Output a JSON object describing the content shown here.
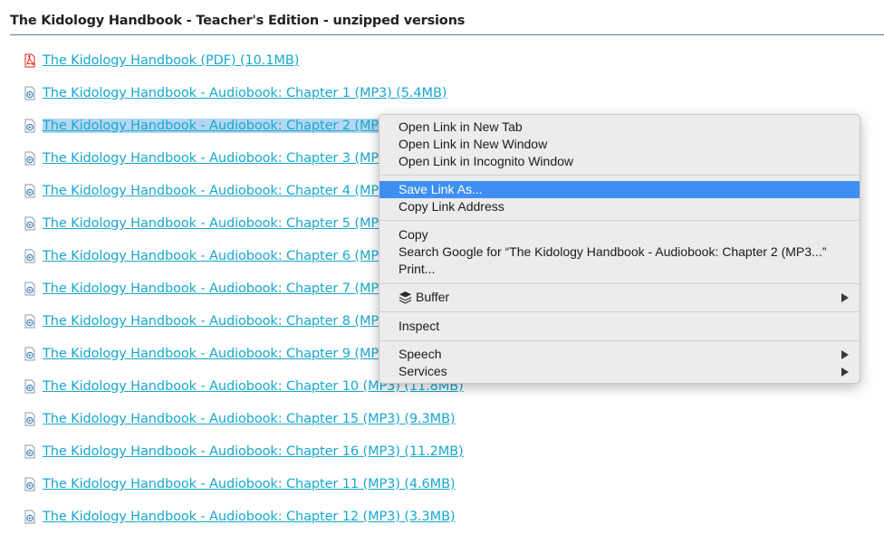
{
  "section": {
    "title": "The Kidology Handbook - Teacher's Edition - unzipped versions"
  },
  "files": [
    {
      "label": "The Kidology Handbook (PDF) (10.1MB)",
      "icon": "pdf-icon"
    },
    {
      "label": "The Kidology Handbook - Audiobook: Chapter 1 (MP3) (5.4MB)",
      "icon": "audio-file-icon"
    },
    {
      "label": "The Kidology Handbook - Audiobook: Chapter 2 (MP3",
      "icon": "audio-file-icon",
      "selected": true
    },
    {
      "label": "The Kidology Handbook - Audiobook: Chapter 3 (MP3",
      "icon": "audio-file-icon"
    },
    {
      "label": "The Kidology Handbook - Audiobook: Chapter 4 (MP3",
      "icon": "audio-file-icon"
    },
    {
      "label": "The Kidology Handbook - Audiobook: Chapter 5 (MP3",
      "icon": "audio-file-icon"
    },
    {
      "label": "The Kidology Handbook - Audiobook: Chapter 6 (MP3",
      "icon": "audio-file-icon"
    },
    {
      "label": "The Kidology Handbook - Audiobook: Chapter 7 (MP3",
      "icon": "audio-file-icon"
    },
    {
      "label": "The Kidology Handbook - Audiobook: Chapter 8 (MP3",
      "icon": "audio-file-icon"
    },
    {
      "label": "The Kidology Handbook - Audiobook: Chapter 9 (MP3",
      "icon": "audio-file-icon"
    },
    {
      "label": "The Kidology Handbook - Audiobook: Chapter 10 (MP3) (11.8MB)",
      "icon": "audio-file-icon"
    },
    {
      "label": "The Kidology Handbook - Audiobook: Chapter 15 (MP3) (9.3MB)",
      "icon": "audio-file-icon"
    },
    {
      "label": "The Kidology Handbook - Audiobook: Chapter 16 (MP3) (11.2MB)",
      "icon": "audio-file-icon"
    },
    {
      "label": "The Kidology Handbook - Audiobook: Chapter 11 (MP3) (4.6MB)",
      "icon": "audio-file-icon"
    },
    {
      "label": "The Kidology Handbook - Audiobook: Chapter 12 (MP3) (3.3MB)",
      "icon": "audio-file-icon"
    }
  ],
  "context_menu": {
    "open_new_tab": "Open Link in New Tab",
    "open_new_window": "Open Link in New Window",
    "open_incognito": "Open Link in Incognito Window",
    "save_link_as": "Save Link As...",
    "copy_link_address": "Copy Link Address",
    "copy": "Copy",
    "search_google": "Search Google for “The Kidology Handbook - Audiobook: Chapter 2 (MP3...”",
    "print": "Print...",
    "buffer": "Buffer",
    "inspect": "Inspect",
    "speech": "Speech",
    "services": "Services",
    "highlighted_item": "Save Link As..."
  },
  "colors": {
    "link": "#18a7cc",
    "selection": "#b3d7f3",
    "menu_highlight": "#3f8ff2",
    "pdf_icon": "#e2231a"
  }
}
